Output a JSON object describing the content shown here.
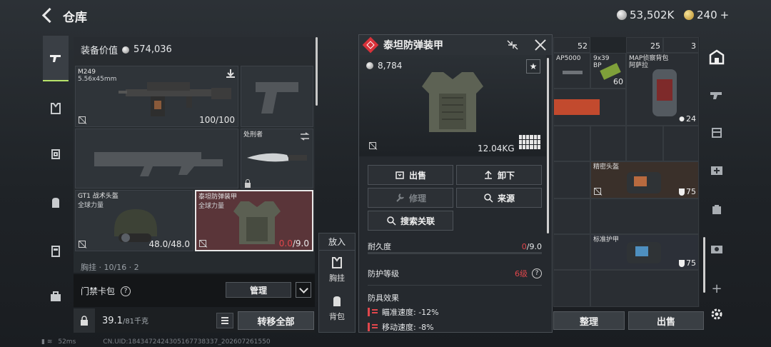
{
  "header": {
    "title": "仓库",
    "currency_silver": "53,502K",
    "currency_gold": "240",
    "add_symbol": "+"
  },
  "equipment": {
    "value_label": "装备价值",
    "value": "574,036",
    "primary": {
      "name": "M249",
      "sub": "5.56x45mm",
      "durability": "100/100"
    },
    "melee": {
      "name": "处刑者"
    },
    "helmet": {
      "name": "GT1 战术头盔",
      "sub": "全球力量",
      "durability": "48.0/48.0"
    },
    "armor": {
      "name": "泰坦防弹装甲",
      "sub": "全球力量",
      "durability_cur": "0.0",
      "durability_max": "/9.0"
    },
    "chest_label": "胸挂 · 10/16 · 2"
  },
  "keycard": {
    "label": "门禁卡包",
    "help": "?",
    "manage": "管理"
  },
  "weight": {
    "value": "39.1",
    "max": "/81",
    "unit": "千克",
    "transfer": "转移全部"
  },
  "putin": {
    "title": "放入",
    "chest": "胸挂",
    "backpack": "背包"
  },
  "detail": {
    "title": "泰坦防弹装甲",
    "price": "8,784",
    "star": "★",
    "weight": "12.04KG",
    "actions": {
      "sell": "出售",
      "unequip": "卸下",
      "repair": "修理",
      "source": "来源",
      "search": "搜索关联"
    },
    "durability_label": "耐久度",
    "durability_cur": "0",
    "durability_max": "/9.0",
    "protection_label": "防护等级",
    "protection_value": "6级",
    "effects_label": "防具效果",
    "effect1": "瞄准速度: -12%",
    "effect2": "移动速度: -8%"
  },
  "storage": {
    "top_counts": [
      "52",
      "25",
      "3"
    ],
    "ammo1": "AP5000",
    "ammo2": "9x39",
    "ammo2_sub": "BP",
    "ammo2_count": "60",
    "bag_name": "MAP侦察背包",
    "bag_sub": "阿萨拉",
    "bag_count": "24",
    "bag1_name": "精密头盔",
    "bag1_dur": "75",
    "bag2_name": "标准护甲",
    "bag2_dur": "75",
    "sort": "整理",
    "sell": "出售"
  },
  "status": {
    "ping": "52ms",
    "uid": "CN.UID:1843472424305167738337_202607261550"
  },
  "colors": {
    "accent_green": "#b7e36a",
    "danger_red": "#e0474c",
    "armor_slot_bg": "#5a3539"
  }
}
